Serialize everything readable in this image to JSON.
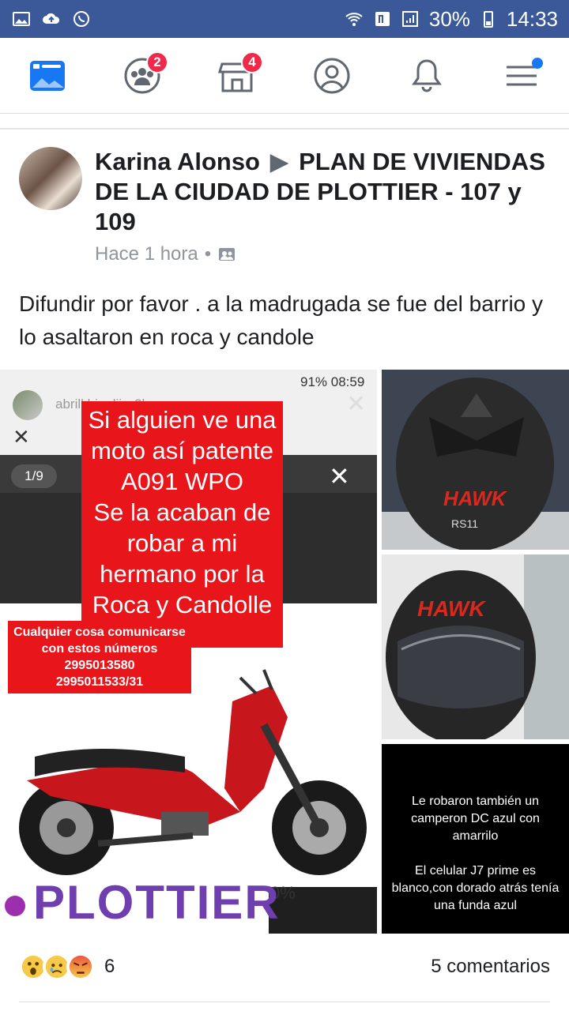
{
  "status_bar": {
    "battery": "30%",
    "time": "14:33",
    "icons": [
      "image-icon",
      "cloud-upload-icon",
      "whatsapp-icon",
      "wifi-icon",
      "nfc-icon",
      "signal-icon"
    ]
  },
  "nav": {
    "items": [
      {
        "name": "news-feed",
        "icon": "news-feed-icon",
        "badge": ""
      },
      {
        "name": "friends",
        "icon": "friends-icon",
        "badge": "2"
      },
      {
        "name": "marketplace",
        "icon": "store-icon",
        "badge": "4"
      },
      {
        "name": "profile",
        "icon": "profile-icon",
        "badge": ""
      },
      {
        "name": "notifications",
        "icon": "bell-icon",
        "badge": ""
      },
      {
        "name": "menu",
        "icon": "menu-icon",
        "badge": ""
      }
    ],
    "accent": "#1877f2",
    "badge_color": "#f02849"
  },
  "post": {
    "author": "Karina Alonso",
    "group": "PLAN DE VIVIENDAS DE LA CIUDAD DE PLOTTIER - 107 y 109",
    "time": "Hace 1 hora",
    "separator": "•",
    "text": "Difundir por favor . a la madrugada se fue del barrio y lo asaltaron en roca y candole"
  },
  "photo_main": {
    "status": "91% 08:59",
    "username": "abrill.biaalii",
    "ago": "2h",
    "counter": "1/9",
    "headline": [
      "Si alguien ve una",
      "moto así patente",
      "A091 WPO",
      "Se la acaban de",
      "robar a mi",
      "hermano por la",
      "Roca y Candolle"
    ],
    "contact": [
      "Cualquier cosa comunicarse",
      "con estos números",
      "2995013580",
      "2995011533/31"
    ],
    "footer_brand": "PLOTTIER",
    "partial_percent": "0%"
  },
  "photo_helmet_1": {
    "brand": "HAWK",
    "model": "RS11"
  },
  "photo_helmet_2": {
    "brand": "HAWK"
  },
  "photo_text": {
    "line1": "Le robaron también un camperon DC azul con amarrilo",
    "line2": "El celular J7 prime es blanco,con dorado atrás tenía una funda azul"
  },
  "footer": {
    "reactions": [
      "wow-icon",
      "sad-icon",
      "angry-icon"
    ],
    "reaction_count": "6",
    "comments": "5 comentarios"
  }
}
